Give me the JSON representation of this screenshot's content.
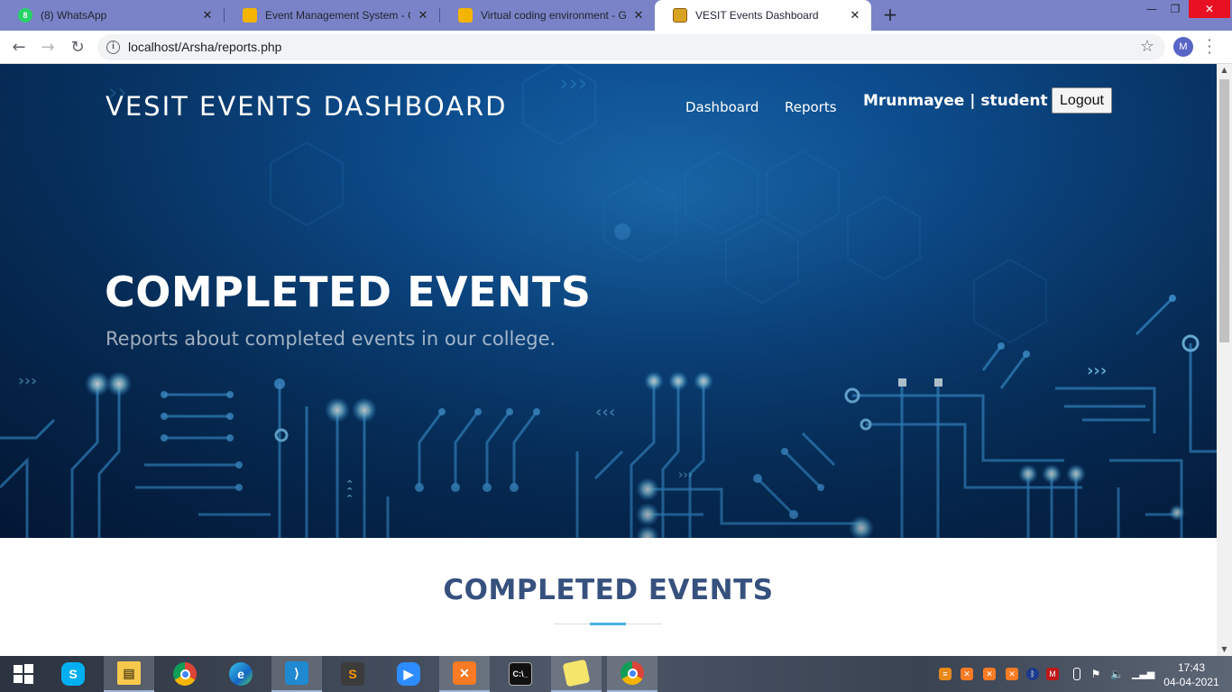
{
  "browser": {
    "tabs": [
      {
        "title": "(8) WhatsApp",
        "icon": "whatsapp-icon"
      },
      {
        "title": "Event Management System - Goo",
        "icon": "google-slides-icon"
      },
      {
        "title": "Virtual coding environment - Goo",
        "icon": "google-slides-icon"
      },
      {
        "title": "VESIT Events Dashboard",
        "icon": "vesit-logo-icon"
      }
    ],
    "new_tab_label": "+",
    "url": "localhost/Arsha/reports.php",
    "profile_initial": "M"
  },
  "header": {
    "brand": "VESIT EVENTS DASHBOARD",
    "nav": {
      "dashboard": "Dashboard",
      "reports": "Reports",
      "user": "Mrunmayee | student",
      "logout": "Logout"
    }
  },
  "hero": {
    "title": "COMPLETED EVENTS",
    "subtitle": "Reports about completed events in our college."
  },
  "section": {
    "title": "COMPLETED EVENTS"
  },
  "taskbar": {
    "apps": [
      "start-icon",
      "skype-icon",
      "file-explorer-icon",
      "chrome-icon",
      "edge-icon",
      "vscode-icon",
      "sublime-text-icon",
      "zoom-icon",
      "xampp-icon",
      "command-prompt-icon",
      "sticky-notes-icon",
      "chrome-profile-icon"
    ],
    "time": "17:43",
    "date": "04-04-2021"
  },
  "colors": {
    "tabstrip": "#7b83c8",
    "hero_dark": "#041a3b",
    "hero_light": "#1b6fb5",
    "section_title": "#37517e",
    "accent": "#47b2e4"
  }
}
